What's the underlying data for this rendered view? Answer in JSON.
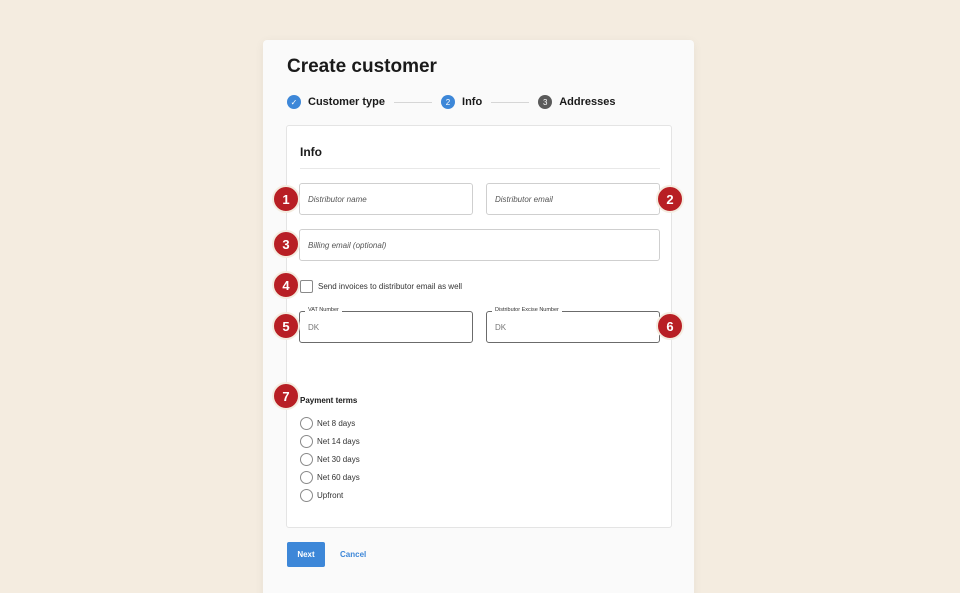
{
  "form": {
    "title": "Create customer",
    "steps": [
      {
        "number": "✓",
        "label": "Customer type",
        "state": "done"
      },
      {
        "number": "2",
        "label": "Info",
        "state": "active"
      },
      {
        "number": "3",
        "label": "Addresses",
        "state": "todo"
      }
    ],
    "card_title": "Info",
    "distributor_name_placeholder": "Distributor name",
    "distributor_email_placeholder": "Distributor email",
    "billing_email_placeholder": "Billing email (optional)",
    "send_invoices_label": "Send invoices to distributor email as well",
    "send_invoices_checked": false,
    "vat": {
      "label": "VAT Number",
      "value": "DK"
    },
    "excise": {
      "label": "Distributor Excise Number",
      "value": "DK"
    },
    "payment_terms": {
      "label": "Payment terms",
      "options": [
        "Net 8 days",
        "Net 14 days",
        "Net 30 days",
        "Net 60 days",
        "Upfront"
      ]
    },
    "next_label": "Next",
    "cancel_label": "Cancel"
  },
  "annotations": [
    "1",
    "2",
    "3",
    "4",
    "5",
    "6",
    "7"
  ],
  "colors": {
    "background": "#f4ece0",
    "accent": "#3d87d8",
    "badge": "#b81f24"
  }
}
